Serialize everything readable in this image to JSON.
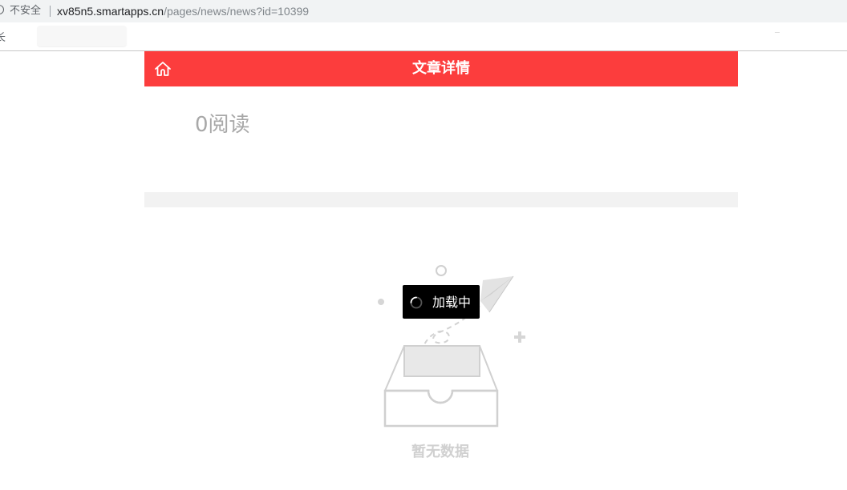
{
  "browser": {
    "security_label": "不安全",
    "url_host": "xv85n5.smartapps.cn",
    "url_path": "/pages/news/news?id=10399",
    "bookmark_partial_char": "长"
  },
  "header": {
    "title": "文章详情",
    "background": "#fc3d3d",
    "home_icon": "home-icon"
  },
  "article": {
    "read_count": "0阅读"
  },
  "empty_state": {
    "text": "暂无数据",
    "illustration": "empty-box-paper-plane-illustration"
  },
  "toast": {
    "label": "加载中",
    "icon": "spinner-icon"
  }
}
